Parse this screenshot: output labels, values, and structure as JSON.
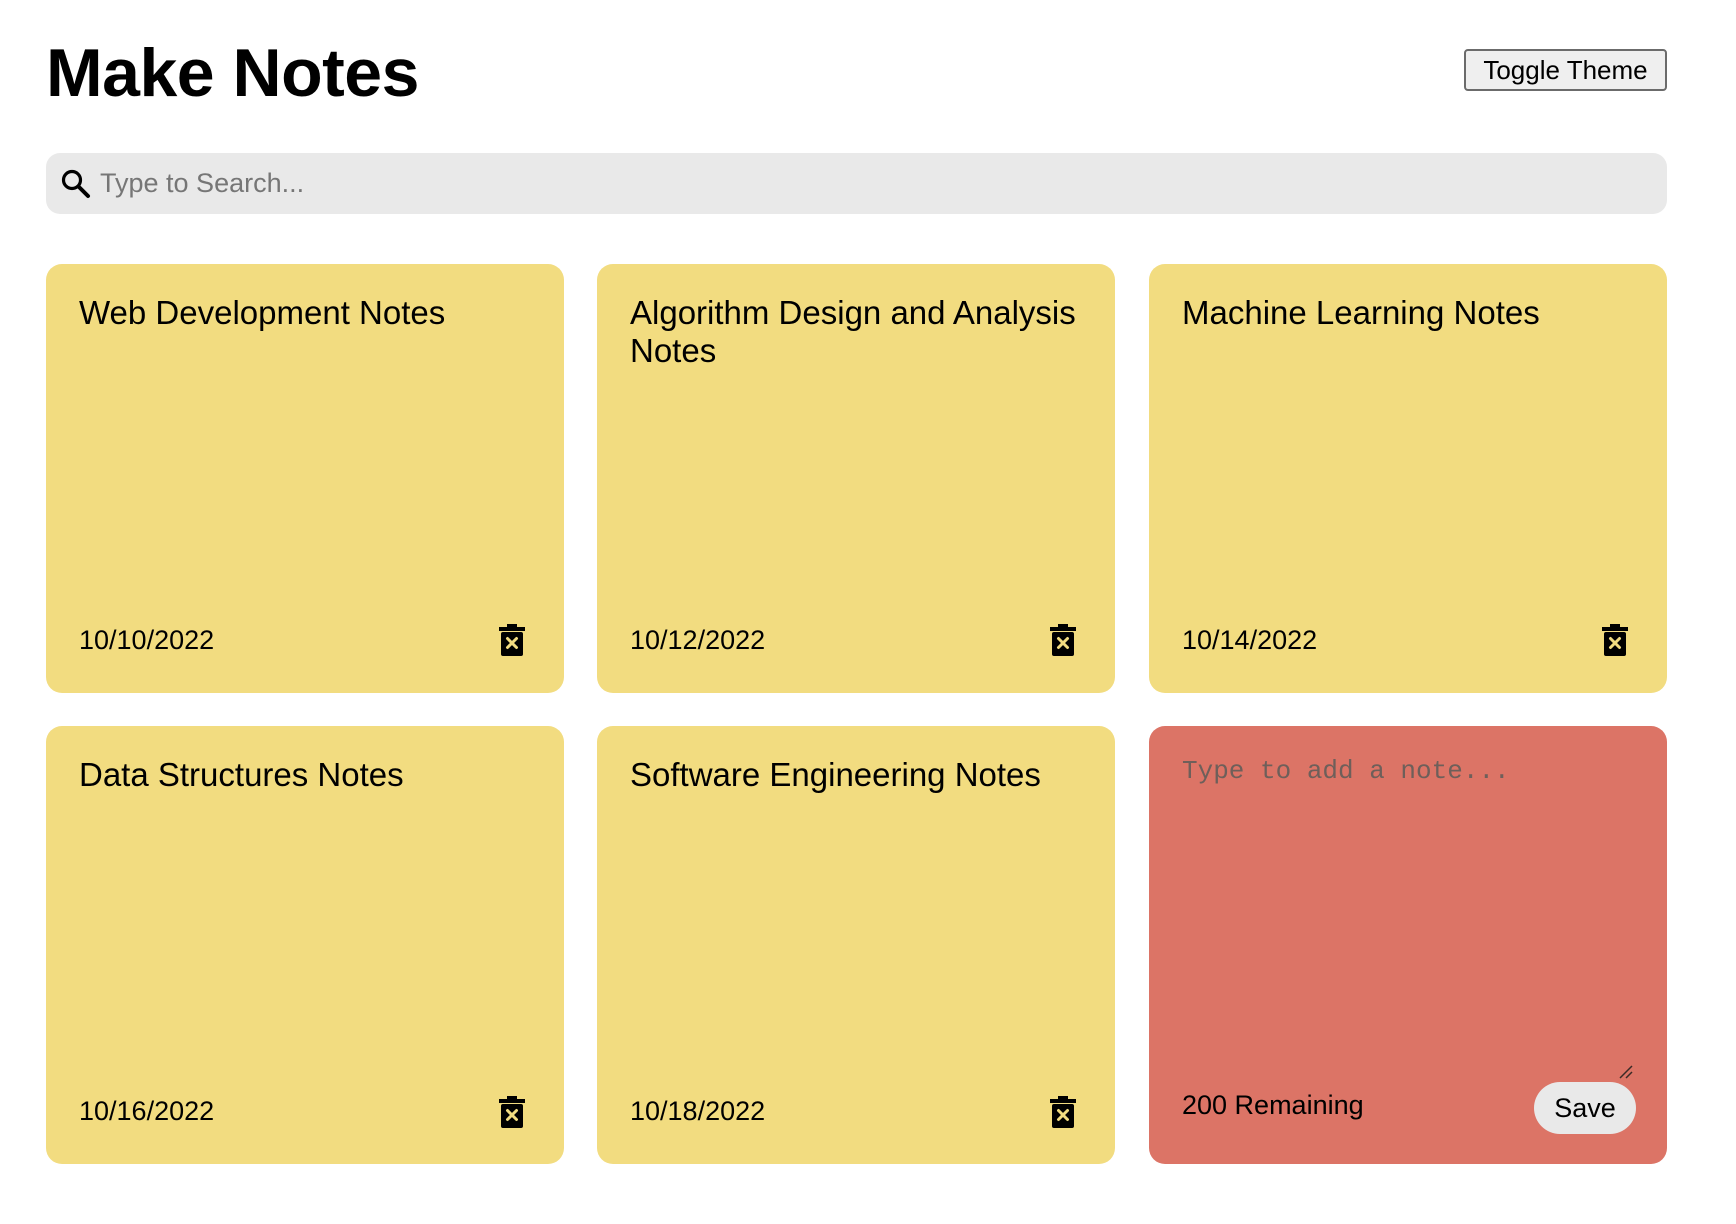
{
  "header": {
    "title": "Make Notes",
    "toggle_label": "Toggle Theme"
  },
  "search": {
    "placeholder": "Type to Search...",
    "icon": "search-icon"
  },
  "notes": [
    {
      "text": "Web Development Notes",
      "date": "10/10/2022",
      "icon": "trash-icon"
    },
    {
      "text": "Algorithm Design and Analysis Notes",
      "date": "10/12/2022",
      "icon": "trash-icon"
    },
    {
      "text": "Machine Learning Notes",
      "date": "10/14/2022",
      "icon": "trash-icon"
    },
    {
      "text": "Data Structures Notes",
      "date": "10/16/2022",
      "icon": "trash-icon"
    },
    {
      "text": "Software Engineering Notes",
      "date": "10/18/2022",
      "icon": "trash-icon"
    }
  ],
  "new_note": {
    "placeholder": "Type to add a note...",
    "remaining": "200 Remaining",
    "save_label": "Save"
  },
  "colors": {
    "note": "#f2dc80",
    "new_note": "#dc7466",
    "search_bg": "#e9e9e9"
  }
}
